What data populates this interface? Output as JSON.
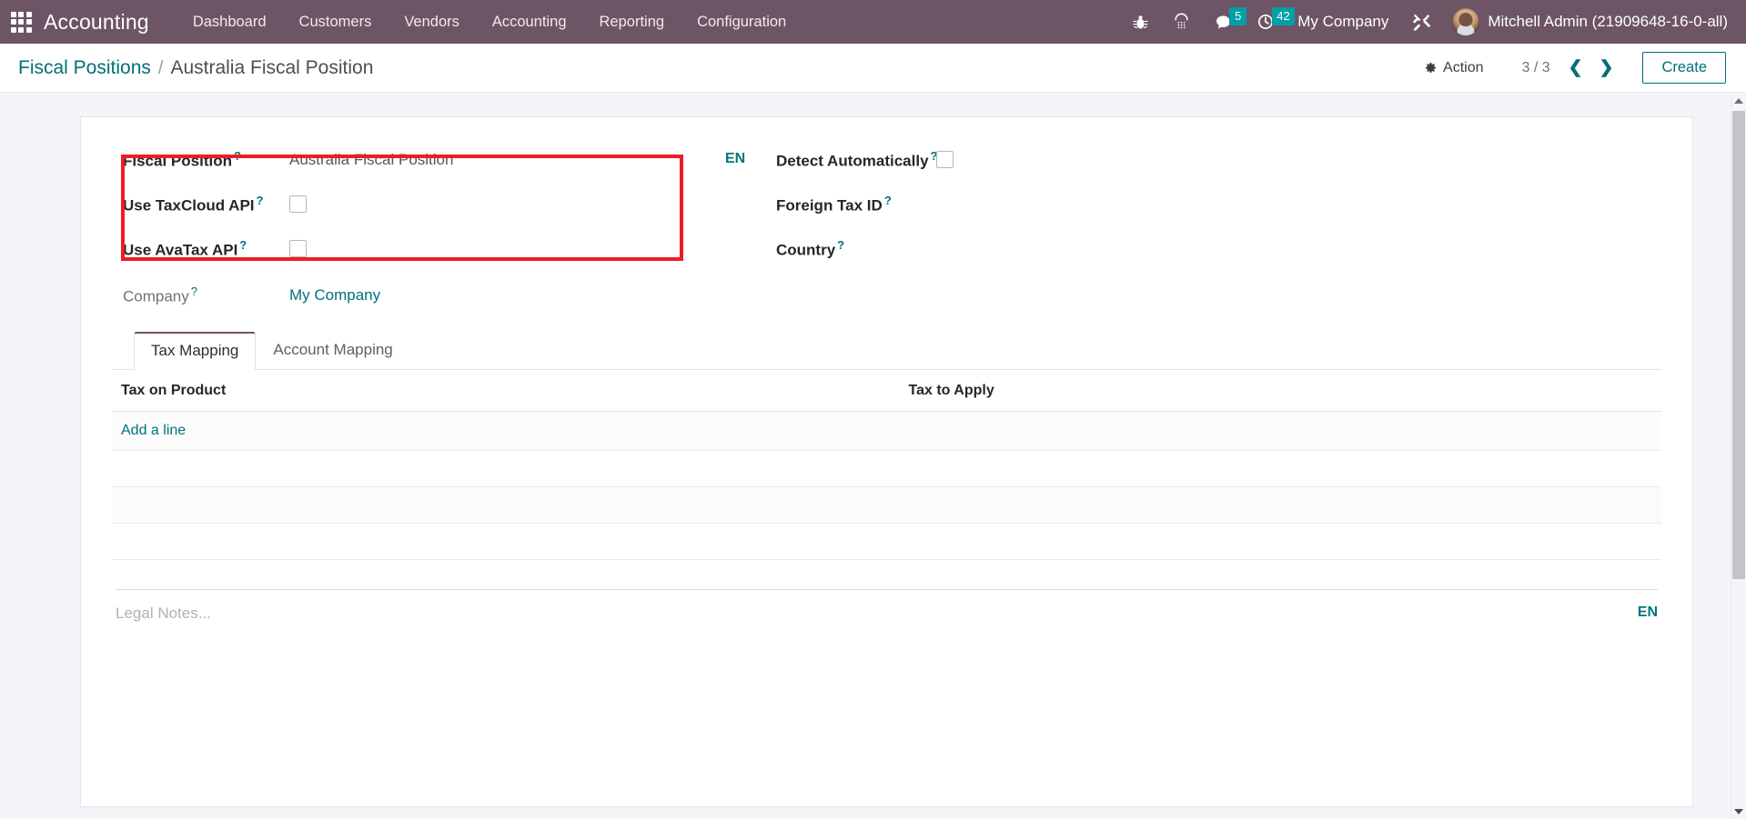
{
  "navbar": {
    "apps_icon": "apps-grid-icon",
    "brand": "Accounting",
    "menu": [
      {
        "label": "Dashboard"
      },
      {
        "label": "Customers"
      },
      {
        "label": "Vendors"
      },
      {
        "label": "Accounting"
      },
      {
        "label": "Reporting"
      },
      {
        "label": "Configuration"
      }
    ],
    "icons": [
      {
        "name": "bug-icon",
        "badge": ""
      },
      {
        "name": "phone-keypad-icon",
        "badge": ""
      },
      {
        "name": "messages-icon",
        "badge": "5"
      },
      {
        "name": "activities-clock-icon",
        "badge": "42"
      }
    ],
    "messages_badge": "5",
    "activities_badge": "42",
    "company": "My Company",
    "tools_icon": "tools-icon",
    "user": "Mitchell Admin (21909648-16-0-all)"
  },
  "control_panel": {
    "breadcrumb_root": "Fiscal Positions",
    "breadcrumb_sep": "/",
    "breadcrumb_current": "Australia Fiscal Position",
    "action_label": "Action",
    "action_icon": "gear-icon",
    "pager": "3 / 3",
    "prev_icon": "chevron-left-icon",
    "next_icon": "chevron-right-icon",
    "create_label": "Create"
  },
  "form": {
    "left": [
      {
        "label": "Fiscal Position",
        "help": "?",
        "type": "text",
        "value": "Australia Fiscal Position"
      },
      {
        "label": "Use TaxCloud API",
        "help": "?",
        "type": "checkbox",
        "value": ""
      },
      {
        "label": "Use AvaTax API",
        "help": "?",
        "type": "checkbox",
        "value": ""
      }
    ],
    "lang_tag": "EN",
    "right": [
      {
        "label": "Detect Automatically",
        "help": "?",
        "type": "checkbox",
        "value": ""
      },
      {
        "label": "Foreign Tax ID",
        "help": "?",
        "type": "text",
        "value": ""
      },
      {
        "label": "Country",
        "help": "?",
        "type": "text",
        "value": ""
      }
    ],
    "company": {
      "label": "Company",
      "help": "?",
      "value": "My Company"
    },
    "highlight_color": "#ee1c25"
  },
  "notebook": {
    "tabs": [
      {
        "label": "Tax Mapping",
        "active": true
      },
      {
        "label": "Account Mapping",
        "active": false
      }
    ],
    "columns": [
      "Tax on Product",
      "Tax to Apply"
    ],
    "rows": [],
    "add_line_label": "Add a line",
    "empty_row_count": 3
  },
  "notes": {
    "placeholder": "Legal Notes...",
    "lang_tag": "EN"
  },
  "colors": {
    "navbar_bg": "#6d5566",
    "accent_teal": "#00707a",
    "badge_bg": "#00a0a8",
    "highlight_red": "#ee1c25",
    "page_bg": "#f4f5f8"
  }
}
